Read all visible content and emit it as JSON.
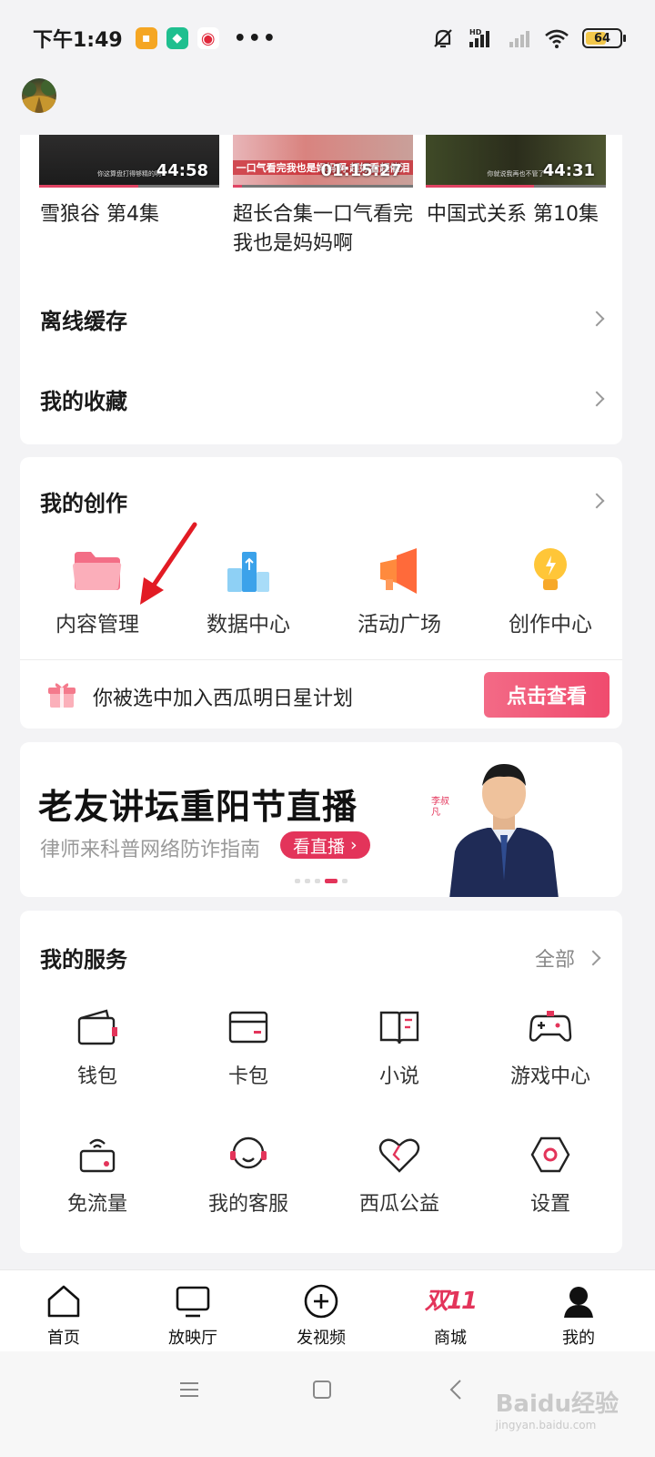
{
  "status_bar": {
    "time": "下午1:49",
    "battery": "64",
    "battery_level": 0.64,
    "network": "HD",
    "apps": [
      "message-icon",
      "shield-app-icon",
      "weibo-icon"
    ],
    "more": "•••"
  },
  "history": {
    "videos": [
      {
        "title": "雪狼谷 第4集",
        "duration": "44:58",
        "caption": "你这算盘打得够精的啊",
        "progress": 0.55
      },
      {
        "title": "超长合集一口气看完我也是妈妈啊",
        "duration": "01:15:27",
        "caption": "一口气看完我也是妈妈啊 超好看超催泪",
        "progress": 0.05
      },
      {
        "title": "中国式关系 第10集",
        "duration": "44:31",
        "caption": "你就说我再也不管了",
        "progress": 0.6
      }
    ]
  },
  "menu": {
    "offline": "离线缓存",
    "favorites": "我的收藏"
  },
  "creation": {
    "title": "我的创作",
    "tools": [
      {
        "label": "内容管理",
        "icon": "folder-icon"
      },
      {
        "label": "数据中心",
        "icon": "data-chart-icon"
      },
      {
        "label": "活动广场",
        "icon": "megaphone-icon"
      },
      {
        "label": "创作中心",
        "icon": "lightbulb-icon"
      }
    ],
    "promo_text": "你被选中加入西瓜明日星计划",
    "promo_button": "点击查看"
  },
  "banner": {
    "title": "老友讲坛重阳节直播",
    "subtitle": "律师来科普网络防诈指南",
    "tag": "看直播",
    "name_tag": "李叔凡"
  },
  "services": {
    "title": "我的服务",
    "all_label": "全部",
    "items": [
      {
        "label": "钱包",
        "icon": "wallet-icon"
      },
      {
        "label": "卡包",
        "icon": "card-icon"
      },
      {
        "label": "小说",
        "icon": "book-icon"
      },
      {
        "label": "游戏中心",
        "icon": "gamepad-icon"
      },
      {
        "label": "免流量",
        "icon": "free-data-icon"
      },
      {
        "label": "我的客服",
        "icon": "headset-icon"
      },
      {
        "label": "西瓜公益",
        "icon": "heart-icon"
      },
      {
        "label": "设置",
        "icon": "settings-icon"
      }
    ]
  },
  "bottom_nav": {
    "items": [
      {
        "label": "首页",
        "icon": "home-icon"
      },
      {
        "label": "放映厅",
        "icon": "tv-icon"
      },
      {
        "label": "发视频",
        "icon": "add-video-icon"
      },
      {
        "label": "商城",
        "icon": "mall-double11-icon",
        "logo_text": "双11"
      },
      {
        "label": "我的",
        "icon": "profile-icon"
      }
    ]
  },
  "watermark": {
    "text": "Baidu经验",
    "sub": "jingyan.baidu.com"
  },
  "colors": {
    "accent": "#e3345a",
    "background": "#f3f3f5"
  }
}
